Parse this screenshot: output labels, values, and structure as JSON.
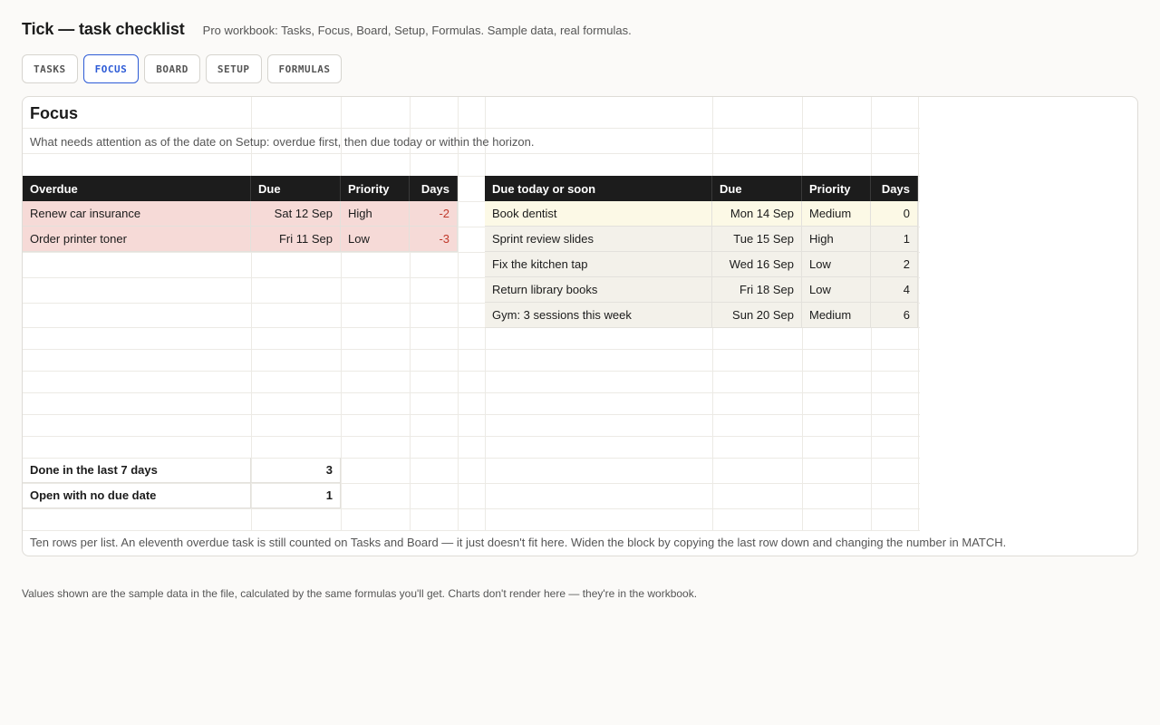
{
  "app": {
    "title": "Tick — task checklist",
    "subtitle": "Pro workbook: Tasks, Focus, Board, Setup, Formulas. Sample data, real formulas."
  },
  "tabs": [
    {
      "label": "TASKS",
      "active": false
    },
    {
      "label": "FOCUS",
      "active": true
    },
    {
      "label": "BOARD",
      "active": false
    },
    {
      "label": "SETUP",
      "active": false
    },
    {
      "label": "FORMULAS",
      "active": false
    }
  ],
  "sheet": {
    "title": "Focus",
    "description": "What needs attention as of the date on Setup: overdue first, then due today or within the horizon.",
    "overdue": {
      "headers": [
        "Overdue",
        "Due",
        "Priority",
        "Days"
      ],
      "rows": [
        {
          "task": "Renew car insurance",
          "due": "Sat 12 Sep",
          "priority": "High",
          "days": "-2"
        },
        {
          "task": "Order printer toner",
          "due": "Fri 11 Sep",
          "priority": "Low",
          "days": "-3"
        }
      ]
    },
    "soon": {
      "headers": [
        "Due today or soon",
        "Due",
        "Priority",
        "Days"
      ],
      "rows": [
        {
          "task": "Book dentist",
          "due": "Mon 14 Sep",
          "priority": "Medium",
          "days": "0",
          "today": true
        },
        {
          "task": "Sprint review slides",
          "due": "Tue 15 Sep",
          "priority": "High",
          "days": "1",
          "today": false
        },
        {
          "task": "Fix the kitchen tap",
          "due": "Wed 16 Sep",
          "priority": "Low",
          "days": "2",
          "today": false
        },
        {
          "task": "Return library books",
          "due": "Fri 18 Sep",
          "priority": "Low",
          "days": "4",
          "today": false
        },
        {
          "task": "Gym: 3 sessions this week",
          "due": "Sun 20 Sep",
          "priority": "Medium",
          "days": "6",
          "today": false
        }
      ]
    },
    "summary": [
      {
        "label": "Done in the last 7 days",
        "value": "3"
      },
      {
        "label": "Open with no due date",
        "value": "1"
      }
    ],
    "note": "Ten rows per list. An eleventh overdue task is still counted on Tasks and Board — it just doesn't fit here. Widen the block by copying the last row down and changing the number in MATCH."
  },
  "footer": "Values shown are the sample data in the file, calculated by the same formulas you'll get. Charts don't render here — they're in the workbook.",
  "colors": {
    "accent": "#2d5bd6",
    "header_bg": "#1c1c1c",
    "overdue_bg": "#f6dad7",
    "overdue_days": "#c0392b",
    "today_bg": "#fcf9e6",
    "soon_bg": "#f3f1ea"
  }
}
